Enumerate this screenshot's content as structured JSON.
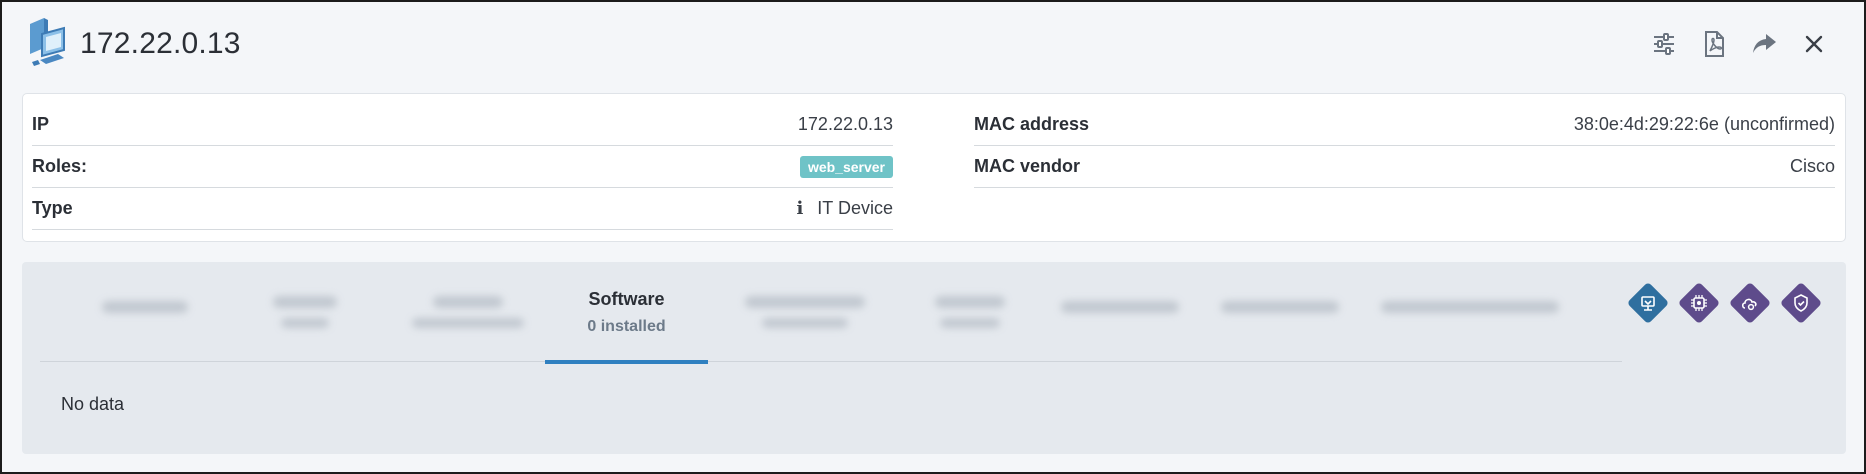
{
  "header": {
    "title": "172.22.0.13",
    "actions": [
      "sliders-icon",
      "pdf-icon",
      "share-icon",
      "close-icon"
    ]
  },
  "info": {
    "left": [
      {
        "label": "IP",
        "value": "172.22.0.13"
      },
      {
        "label": "Roles:",
        "value": "web_server"
      },
      {
        "label": "Type",
        "value": "IT Device",
        "icon": "info-icon"
      }
    ],
    "right": [
      {
        "label": "MAC address",
        "value": "38:0e:4d:29:22:6e (unconfirmed)"
      },
      {
        "label": "MAC vendor",
        "value": "Cisco"
      }
    ]
  },
  "tabs": {
    "active": {
      "title": "Software",
      "subtitle": "0 installed"
    }
  },
  "content": {
    "empty_text": "No data"
  },
  "colors": {
    "accent": "#2f80c0",
    "badge": "#6fc3c7",
    "diamond_blue": "#2f6f9f",
    "diamond_purple": "#5e4b8b"
  }
}
